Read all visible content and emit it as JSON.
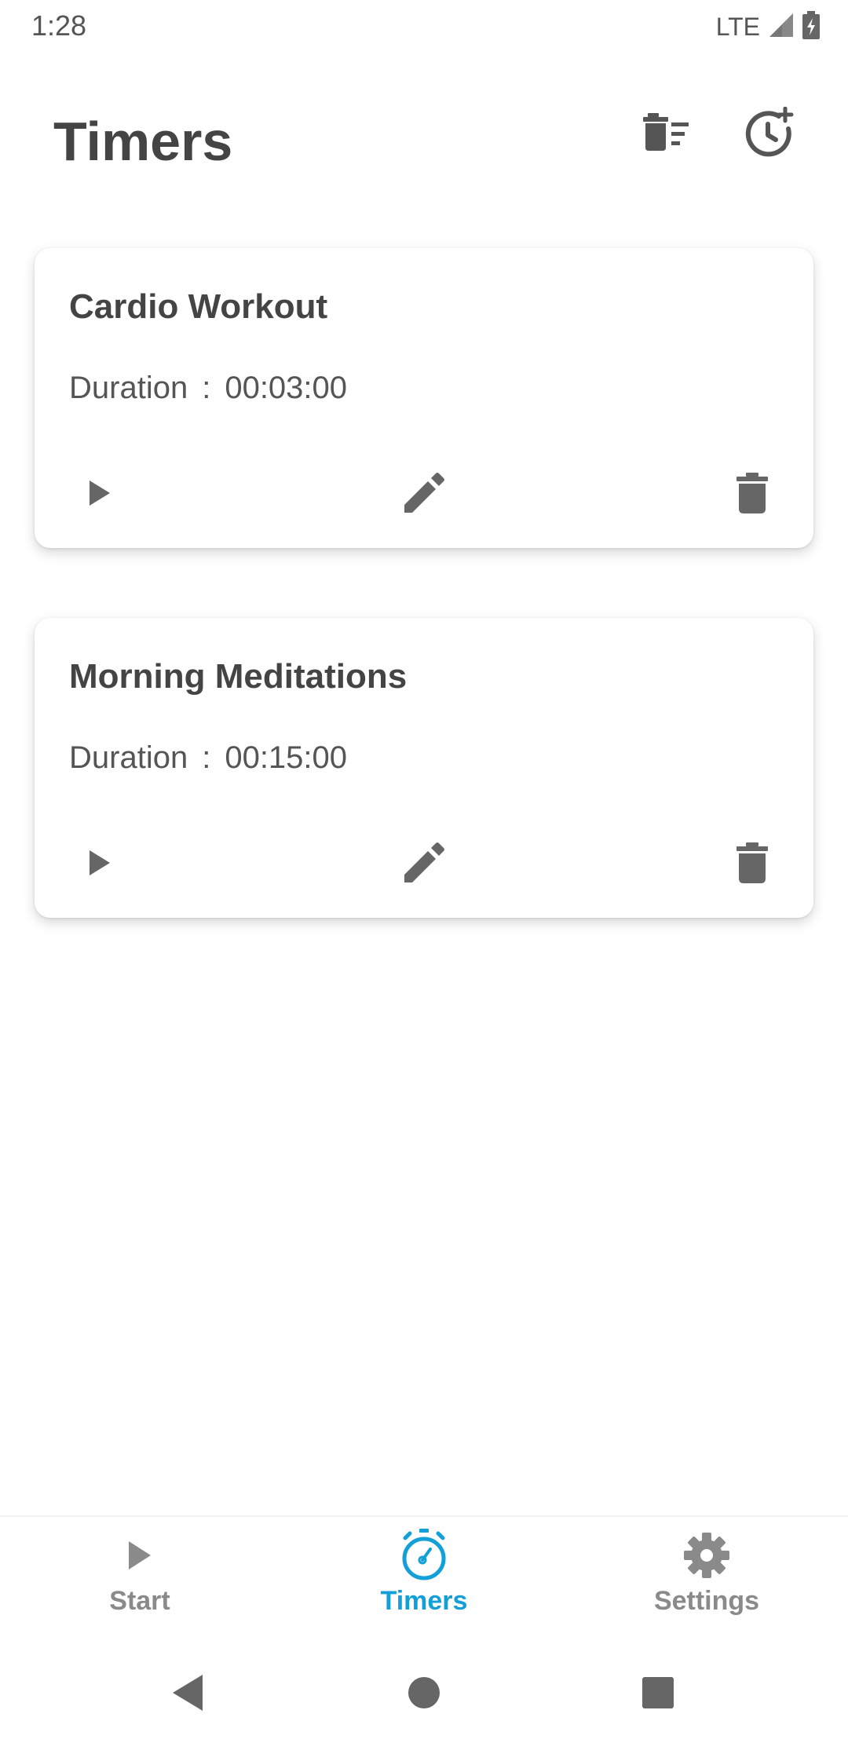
{
  "status_bar": {
    "time": "1:28",
    "network": "LTE"
  },
  "header": {
    "title": "Timers"
  },
  "timers": [
    {
      "name": "Cardio Workout",
      "duration_label": "Duration",
      "separator": ":",
      "duration": "00:03:00"
    },
    {
      "name": "Morning Meditations",
      "duration_label": "Duration",
      "separator": ":",
      "duration": "00:15:00"
    }
  ],
  "bottom_nav": {
    "start_label": "Start",
    "timers_label": "Timers",
    "settings_label": "Settings",
    "active": "Timers"
  },
  "colors": {
    "accent": "#139fd8",
    "icon": "#666666",
    "text": "#444444"
  }
}
